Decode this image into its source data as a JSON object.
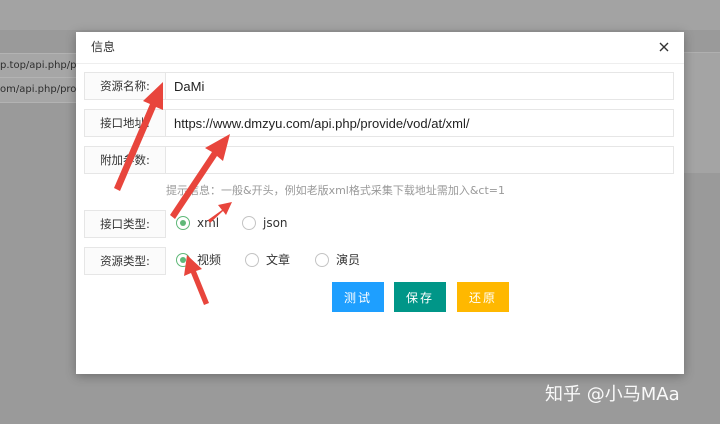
{
  "background": {
    "rows": [
      {
        "text": "p.top/api.php/prov"
      },
      {
        "text": "om/api.php/provi"
      }
    ]
  },
  "dialog": {
    "title": "信息",
    "fields": {
      "name": {
        "label": "资源名称:",
        "value": "DaMi"
      },
      "url": {
        "label": "接口地址:",
        "value": "https://www.dmzyu.com/api.php/provide/vod/at/xml/"
      },
      "params": {
        "label": "附加参数:",
        "value": ""
      }
    },
    "hint": "提示信息：一般&开头，例如老版xml格式采集下载地址需加入&ct=1",
    "api_type": {
      "label": "接口类型:",
      "options": [
        "xml",
        "json"
      ],
      "selected": "xml"
    },
    "resource_type": {
      "label": "资源类型:",
      "options": [
        "视频",
        "文章",
        "演员"
      ],
      "selected": "视频"
    },
    "buttons": {
      "test": "测试",
      "save": "保存",
      "reset": "还原"
    }
  },
  "colors": {
    "accent_green": "#5fb878",
    "btn_blue": "#1e9fff",
    "btn_teal": "#009688",
    "btn_yellow": "#ffb800",
    "arrow_red": "#e8453c"
  },
  "watermark": "知乎 @小马MAa"
}
